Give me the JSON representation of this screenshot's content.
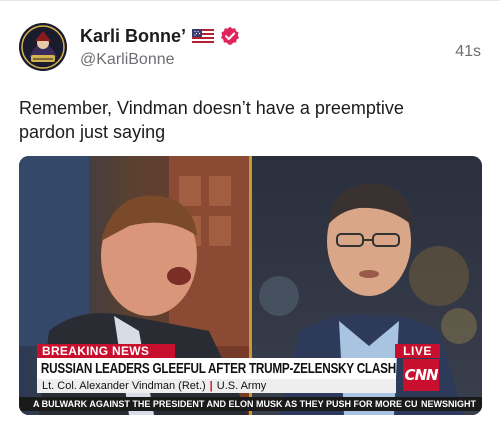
{
  "post": {
    "author": {
      "display_name": "Karli Bonne’",
      "handle": "@KarliBonne",
      "avatar_icon": "avatar-image",
      "flag_icon": "us-flag-icon",
      "verified_icon": "verified-badge-icon",
      "verified_color": "#e0245e"
    },
    "timestamp": "41s",
    "text": "Remember, Vindman doesn’t have a preemptive pardon just saying"
  },
  "media": {
    "breaking_label": "BREAKING NEWS",
    "live_label": "LIVE",
    "headline": "RUSSIAN LEADERS GLEEFUL AFTER TRUMP-ZELENSKY CLASH",
    "guest_name": "Lt. Col. Alexander Vindman (Ret.)",
    "guest_affiliation": "U.S. Army",
    "network_logo": "CNN",
    "ticker_text": "A BULWARK AGAINST THE PRESIDENT AND ELON MUSK AS THEY PUSH FOR MORE CU",
    "ticker_brand": "NEWSNIGHT",
    "brand_color": "#c8102e"
  }
}
